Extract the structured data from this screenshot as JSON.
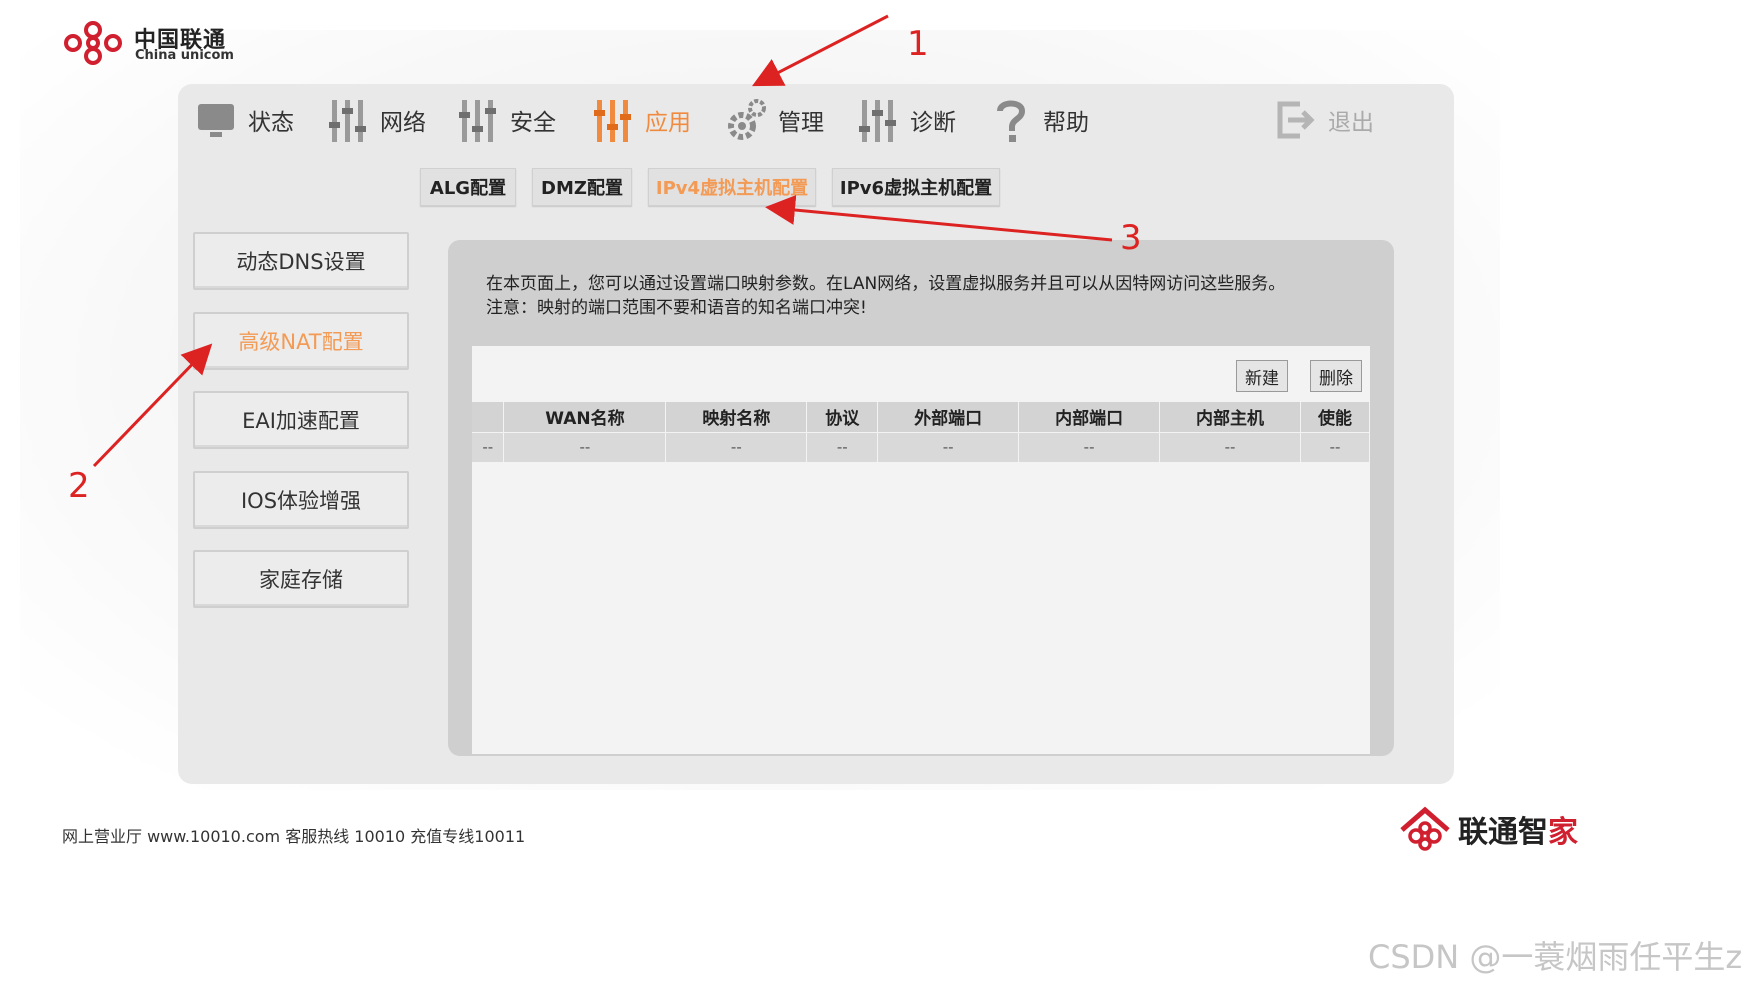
{
  "logo": {
    "cn": "中国联通",
    "en": "China unicom"
  },
  "nav": {
    "items": [
      {
        "label": "状态",
        "icon": "monitor-icon",
        "state": "normal"
      },
      {
        "label": "网络",
        "icon": "sliders-icon",
        "state": "normal"
      },
      {
        "label": "安全",
        "icon": "sliders-icon",
        "state": "normal"
      },
      {
        "label": "应用",
        "icon": "sliders-icon",
        "state": "active"
      },
      {
        "label": "管理",
        "icon": "gear-icon",
        "state": "normal"
      },
      {
        "label": "诊断",
        "icon": "sliders-icon",
        "state": "normal"
      },
      {
        "label": "帮助",
        "icon": "question-icon",
        "state": "normal"
      },
      {
        "label": "退出",
        "icon": "logout-icon",
        "state": "disabled"
      }
    ]
  },
  "subtabs": [
    {
      "label": "ALG配置"
    },
    {
      "label": "DMZ配置"
    },
    {
      "label": "IPv4虚拟主机配置",
      "active": true
    },
    {
      "label": "IPv6虚拟主机配置"
    }
  ],
  "sidebar": {
    "items": [
      {
        "label": "动态DNS设置"
      },
      {
        "label": "高级NAT配置",
        "active": true
      },
      {
        "label": "EAI加速配置"
      },
      {
        "label": "IOS体验增强"
      },
      {
        "label": "家庭存储"
      }
    ]
  },
  "content": {
    "desc_line1": "在本页面上，您可以通过设置端口映射参数。在LAN网络，设置虚拟服务并且可以从因特网访问这些服务。",
    "desc_line2": "注意：映射的端口范围不要和语音的知名端口冲突!",
    "new_button": "新建",
    "delete_button": "删除",
    "table": {
      "headers": [
        "",
        "WAN名称",
        "映射名称",
        "协议",
        "外部端口",
        "内部端口",
        "内部主机",
        "使能"
      ],
      "rows": [
        [
          "--",
          "--",
          "--",
          "--",
          "--",
          "--",
          "--",
          "--"
        ]
      ]
    }
  },
  "footer": {
    "text": "网上营业厅 www.10010.com  客服热线  10010  充值专线10011",
    "brand_prefix": "联通智",
    "brand_suffix": "家"
  },
  "watermark": "CSDN @一蓑烟雨任平生z",
  "annotations": {
    "n1": "1",
    "n2": "2",
    "n3": "3"
  },
  "colors": {
    "accent": "#f08a3e",
    "annotation": "#dd2222",
    "brand_red": "#d01f2f"
  }
}
